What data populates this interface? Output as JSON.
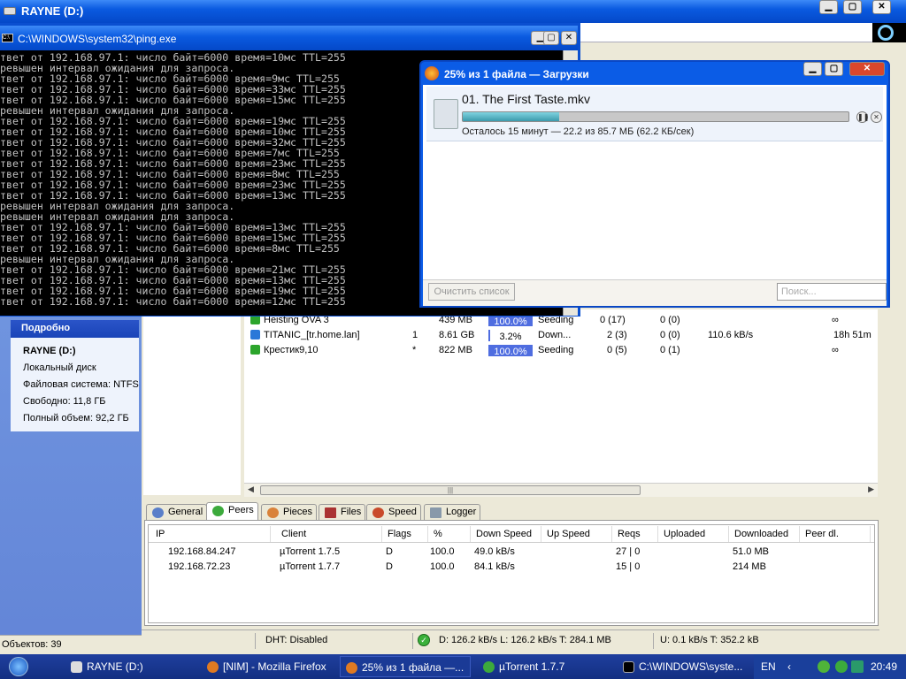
{
  "explorer": {
    "title": "RAYNE (D:)",
    "details_header": "Подробно",
    "details": {
      "name": "RAYNE (D:)",
      "type": "Локальный диск",
      "fs": "Файловая система: NTFS",
      "free": "Свободно: 11,8 ГБ",
      "total": "Полный объем: 92,2 ГБ"
    },
    "objects": "Объектов: 39"
  },
  "cmd": {
    "title": "C:\\WINDOWS\\system32\\ping.exe",
    "lines": [
      "твет от 192.168.97.1: число байт=6000 время=10мс TTL=255",
      "ревышен интервал ожидания для запроса.",
      "твет от 192.168.97.1: число байт=6000 время=9мс TTL=255",
      "твет от 192.168.97.1: число байт=6000 время=33мс TTL=255",
      "твет от 192.168.97.1: число байт=6000 время=15мс TTL=255",
      "ревышен интервал ожидания для запроса.",
      "твет от 192.168.97.1: число байт=6000 время=19мс TTL=255",
      "твет от 192.168.97.1: число байт=6000 время=10мс TTL=255",
      "твет от 192.168.97.1: число байт=6000 время=32мс TTL=255",
      "твет от 192.168.97.1: число байт=6000 время=7мс TTL=255",
      "твет от 192.168.97.1: число байт=6000 время=23мс TTL=255",
      "твет от 192.168.97.1: число байт=6000 время=8мс TTL=255",
      "твет от 192.168.97.1: число байт=6000 время=23мс TTL=255",
      "твет от 192.168.97.1: число байт=6000 время=13мс TTL=255",
      "ревышен интервал ожидания для запроса.",
      "ревышен интервал ожидания для запроса.",
      "твет от 192.168.97.1: число байт=6000 время=13мс TTL=255",
      "твет от 192.168.97.1: число байт=6000 время=15мс TTL=255",
      "твет от 192.168.97.1: число байт=6000 время=8мс TTL=255",
      "ревышен интервал ожидания для запроса.",
      "твет от 192.168.97.1: число байт=6000 время=21мс TTL=255",
      "твет от 192.168.97.1: число байт=6000 время=13мс TTL=255",
      "твет от 192.168.97.1: число байт=6000 время=19мс TTL=255",
      "твет от 192.168.97.1: число байт=6000 время=12мс TTL=255"
    ]
  },
  "downloads": {
    "title": "25% из 1 файла — Загрузки",
    "file_name": "01. The First Taste.mkv",
    "progress_percent": 25,
    "status": "Осталось 15 минут — 22.2 из 85.7 МБ (62.2 КБ/сек)",
    "clear_button": "Очистить список",
    "search_placeholder": "Поиск..."
  },
  "torrents": {
    "rows": [
      {
        "name": "Heisting OVA 3",
        "num": "",
        "size": "439 MB",
        "done": "100.0%",
        "done_value": 100,
        "status": "Seeding",
        "seeds": "0 (17)",
        "peers": "0 (0)",
        "speed": "",
        "eta": "∞"
      },
      {
        "name": "TITANIC_[tr.home.lan]",
        "num": "1",
        "size": "8.61 GB",
        "done": "3.2%",
        "done_value": 3.2,
        "status": "Down...",
        "seeds": "2 (3)",
        "peers": "0 (0)",
        "speed": "110.6 kB/s",
        "eta": "18h 51m"
      },
      {
        "name": "Крестик9,10",
        "num": "*",
        "size": "822 MB",
        "done": "100.0%",
        "done_value": 100,
        "status": "Seeding",
        "seeds": "0 (5)",
        "peers": "0 (1)",
        "speed": "",
        "eta": "∞"
      }
    ]
  },
  "tabs": [
    "General",
    "Peers",
    "Pieces",
    "Files",
    "Speed",
    "Logger"
  ],
  "peers": {
    "headers": [
      "IP",
      "Client",
      "Flags",
      "%",
      "Down Speed",
      "Up Speed",
      "Reqs",
      "Uploaded",
      "Downloaded",
      "Peer dl."
    ],
    "rows": [
      {
        "ip": "192.168.84.247",
        "client": "µTorrent 1.7.5",
        "flags": "D",
        "pct": "100.0",
        "down": "49.0 kB/s",
        "up": "",
        "reqs": "27 | 0",
        "uploaded": "",
        "downloaded": "51.0 MB",
        "peerdl": ""
      },
      {
        "ip": "192.168.72.23",
        "client": "µTorrent 1.7.7",
        "flags": "D",
        "pct": "100.0",
        "down": "84.1 kB/s",
        "up": "",
        "reqs": "15 | 0",
        "uploaded": "",
        "downloaded": "214 MB",
        "peerdl": ""
      }
    ]
  },
  "status": {
    "dht": "DHT: Disabled",
    "down": "D: 126.2 kB/s L: 126.2 kB/s T: 284.1 MB",
    "up": "U: 0.1 kB/s T: 352.2 kB"
  },
  "taskbar": {
    "items": [
      "RAYNE (D:)",
      "[NIM] - Mozilla Firefox",
      "25% из 1 файла —...",
      "µTorrent 1.7.7",
      "C:\\WINDOWS\\syste..."
    ],
    "lang": "EN",
    "clock": "20:49"
  },
  "colors": {
    "xp_blue": "#0a5ae0",
    "progress_teal": "#2f8fa2",
    "torrent_bar": "#4f6de0"
  }
}
